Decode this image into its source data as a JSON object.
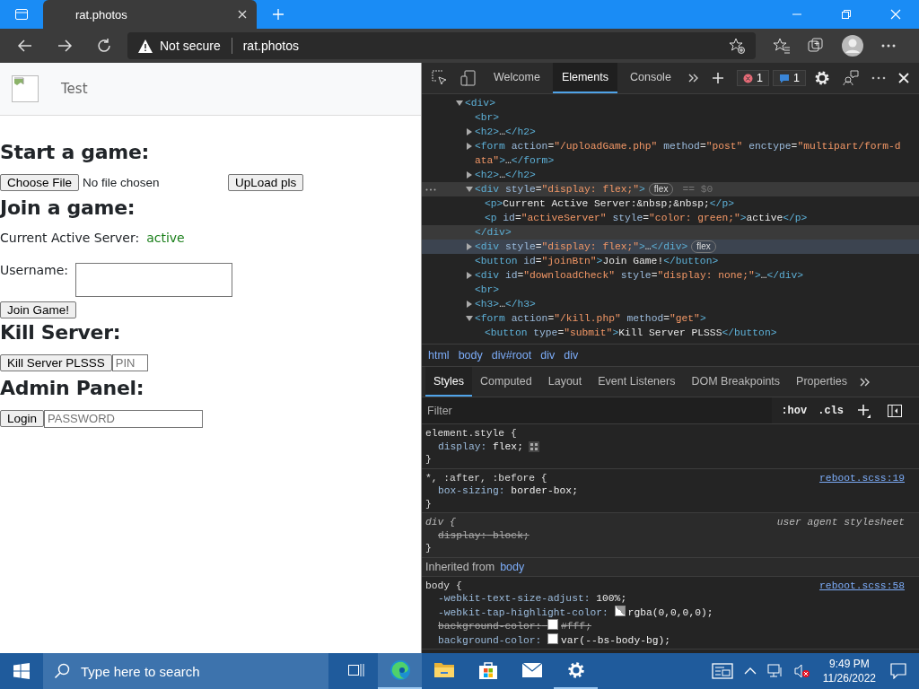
{
  "browser": {
    "tab_title": "rat.photos",
    "security": "Not secure",
    "url": "rat.photos"
  },
  "page": {
    "brand": "Test",
    "start": {
      "heading": "Start a game:",
      "file_button": "Choose File",
      "file_status": "No file chosen",
      "upload_button": "UpLoad pls"
    },
    "join": {
      "heading": "Join a game:",
      "server_label": "Current Active Server:",
      "server_status": "active",
      "username_label": "Username:",
      "join_button": "Join Game!"
    },
    "kill": {
      "heading": "Kill Server:",
      "button": "Kill Server PLSSS",
      "pin_placeholder": "PIN"
    },
    "admin": {
      "heading": "Admin Panel:",
      "button": "Login",
      "password_placeholder": "PASSWORD"
    }
  },
  "devtools": {
    "tabs": [
      {
        "label": "Welcome",
        "selected": false
      },
      {
        "label": "Elements",
        "selected": true
      },
      {
        "label": "Console",
        "selected": false
      }
    ],
    "error_count": "1",
    "message_count": "1",
    "dom": [
      {
        "text": "<div>",
        "expanded": true,
        "children": [
          {
            "text": "<br>"
          },
          {
            "text": "<h2>…</h2>",
            "expanded": false
          },
          {
            "text": "<form action=\"/uploadGame.php\" method=\"post\" enctype=\"multipart/form-data\">…</form>",
            "expanded": false
          },
          {
            "text": "<h2>…</h2>",
            "expanded": false
          },
          {
            "text": "<div style=\"display: flex;\">",
            "expanded": true,
            "badge": "flex",
            "selected": true,
            "marker": "== $0",
            "close": "</div>",
            "children": [
              {
                "text": "<p>Current Active Server:&nbsp;&nbsp;</p>"
              },
              {
                "text": "<p id=\"activeServer\" style=\"color: green;\">active</p>"
              }
            ]
          },
          {
            "text": "<div style=\"display: flex;\">…</div>",
            "expanded": false,
            "badge": "flex",
            "hovered": true
          },
          {
            "text": "<button id=\"joinBtn\">Join Game!</button>"
          },
          {
            "text": "<div id=\"downloadCheck\" style=\"display: none;\">…</div>",
            "expanded": false
          },
          {
            "text": "<br>"
          },
          {
            "text": "<h3>…</h3>",
            "expanded": false
          },
          {
            "text": "<form action=\"/kill.php\" method=\"get\">",
            "expanded": true,
            "children": [
              {
                "text": "<button type=\"submit\">Kill Server PLSSS</button>"
              }
            ]
          }
        ]
      }
    ],
    "breadcrumbs": [
      "html",
      "body",
      "div#root",
      "div",
      "div"
    ],
    "style_tabs": [
      {
        "label": "Styles",
        "selected": true
      },
      {
        "label": "Computed",
        "selected": false
      },
      {
        "label": "Layout",
        "selected": false
      },
      {
        "label": "Event Listeners",
        "selected": false
      },
      {
        "label": "DOM Breakpoints",
        "selected": false
      },
      {
        "label": "Properties",
        "selected": false
      }
    ],
    "filter_placeholder": "Filter",
    "hov": ":hov",
    "cls": ".cls",
    "rules": [
      {
        "kind": "author",
        "selector": "element.style {",
        "close": "}",
        "properties": [
          {
            "name": "display:",
            "value": "flex;",
            "struck": false,
            "editor_icon": true
          }
        ]
      },
      {
        "kind": "author",
        "selector": "*, :after, :before {",
        "source": "reboot.scss:19",
        "close": "}",
        "properties": [
          {
            "name": "box-sizing:",
            "value": "border-box;",
            "struck": false
          }
        ]
      },
      {
        "kind": "user-agent",
        "selector": "div {",
        "source": "user agent stylesheet",
        "close": "}",
        "properties": [
          {
            "name": "display:",
            "value": "block;",
            "struck": true
          }
        ]
      },
      {
        "kind": "inherited",
        "label": "Inherited from",
        "link": "body"
      },
      {
        "kind": "author",
        "selector": "body {",
        "source": "reboot.scss:58",
        "properties": [
          {
            "name": "-webkit-text-size-adjust:",
            "value": "100%;",
            "struck": false
          },
          {
            "name": "-webkit-tap-highlight-color:",
            "value": "rgba(0,0,0,0);",
            "struck": false,
            "swatch": true,
            "transparent": true
          },
          {
            "name": "background-color:",
            "value": "#fff;",
            "struck": true,
            "swatch": true,
            "transparent": false
          },
          {
            "name": "background-color:",
            "value": "var(--bs-body-bg);",
            "struck": false,
            "swatch": true,
            "transparent": false
          }
        ]
      }
    ]
  },
  "taskbar": {
    "search_placeholder": "Type here to search",
    "apps": [
      {
        "kind": "task-view",
        "open": false,
        "selected": false
      },
      {
        "kind": "edge",
        "open": true,
        "selected": true
      },
      {
        "kind": "explorer",
        "open": false,
        "selected": false
      },
      {
        "kind": "store",
        "open": false,
        "selected": false
      },
      {
        "kind": "mail",
        "open": false,
        "selected": false
      },
      {
        "kind": "settings",
        "open": true,
        "selected": false
      }
    ],
    "time": "9:49 PM",
    "date": "11/26/2022"
  }
}
